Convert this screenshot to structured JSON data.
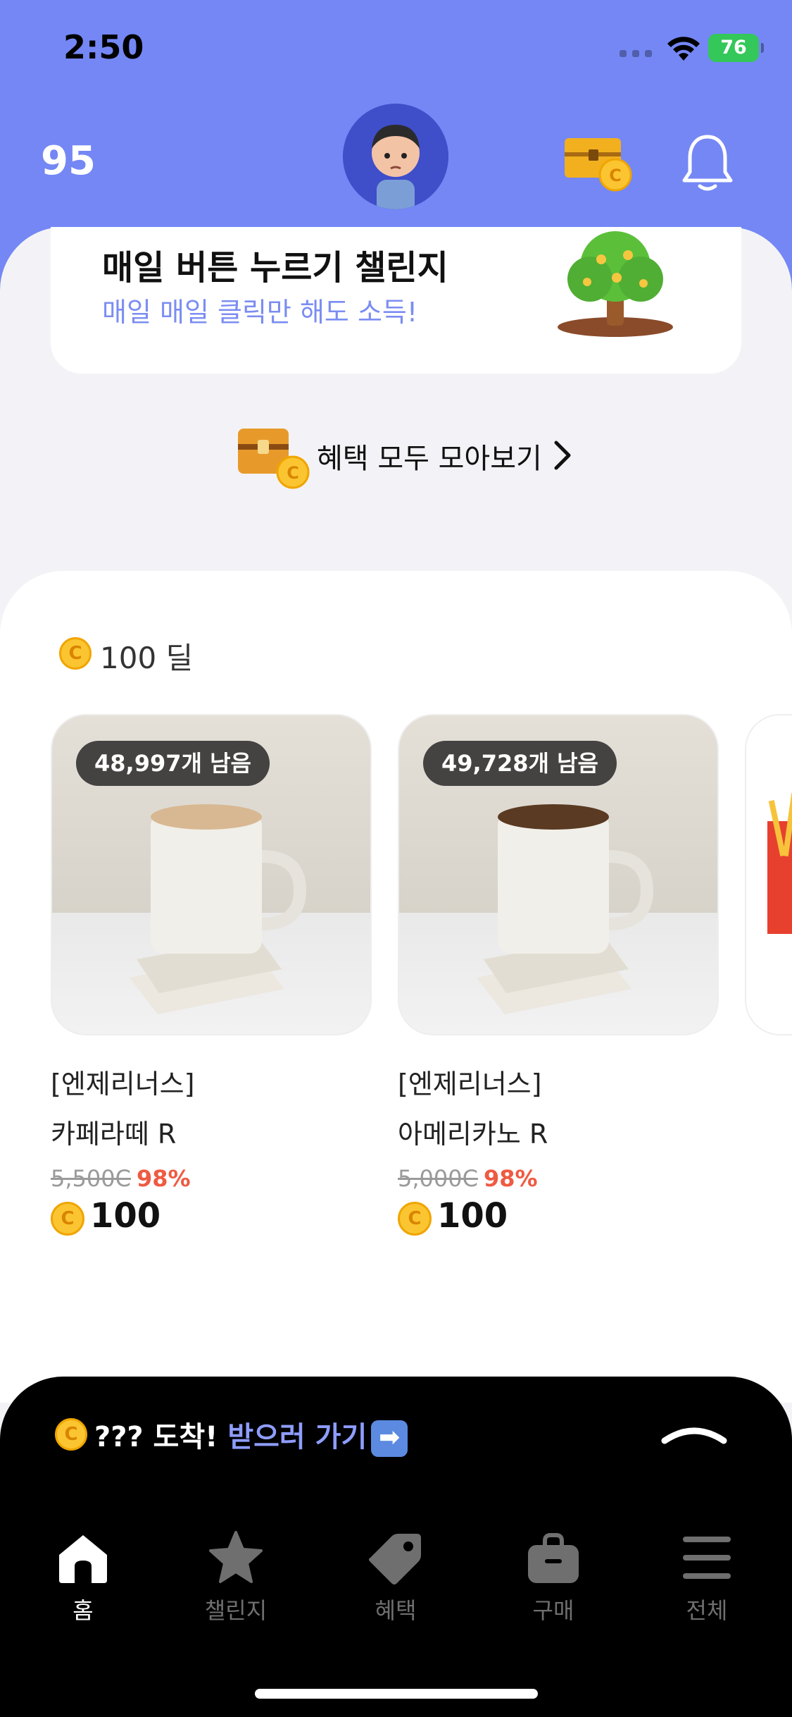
{
  "status_bar": {
    "time": "2:50",
    "battery": "76"
  },
  "header": {
    "points": "95"
  },
  "challenge": {
    "title": "매일 버튼 누르기 챌린지",
    "subtitle": "매일 매일 클릭만 해도 소득!"
  },
  "benefits_link": {
    "label": "혜택 모두 모아보기"
  },
  "deals": {
    "coin_glyph": "C",
    "title": "100 딜",
    "products": [
      {
        "stock": "48,997개 남음",
        "brand": "[엔제리너스]",
        "name": "카페라떼 R",
        "original_price": "5,500C",
        "discount": "98%",
        "price": "100"
      },
      {
        "stock": "49,728개 남음",
        "brand": "[엔제리너스]",
        "name": "아메리카노 R",
        "original_price": "5,000C",
        "discount": "98%",
        "price": "100"
      }
    ]
  },
  "notice": {
    "text": "??? 도착!",
    "link": "받으러 가기",
    "arrow": "➡"
  },
  "tabbar": {
    "tabs": [
      {
        "label": "홈",
        "icon": "home-icon",
        "active": true
      },
      {
        "label": "챌린지",
        "icon": "star-icon",
        "active": false
      },
      {
        "label": "혜택",
        "icon": "tag-icon",
        "active": false
      },
      {
        "label": "구매",
        "icon": "bag-icon",
        "active": false
      },
      {
        "label": "전체",
        "icon": "menu-icon",
        "active": false
      }
    ]
  },
  "colors": {
    "header_blue": "#7487f5",
    "subtitle_blue": "#7b8df2",
    "discount_red": "#ef5a42",
    "coin_yellow": "#fbc531",
    "link_blue": "#8e9dff"
  }
}
